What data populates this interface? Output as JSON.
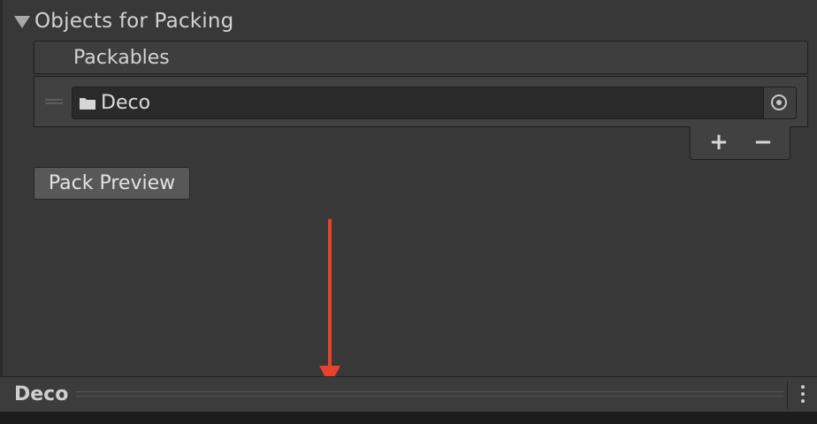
{
  "foldout": {
    "title": "Objects for Packing",
    "expanded": true
  },
  "packables": {
    "header": "Packables",
    "items": [
      {
        "value": "Deco",
        "icon": "folder-icon"
      }
    ],
    "add_label": "+",
    "remove_label": "−"
  },
  "pack_preview_label": "Pack Preview",
  "bottom_bar": {
    "title": "Deco"
  },
  "colors": {
    "annotation_arrow": "#e8412c",
    "background": "#383838"
  }
}
